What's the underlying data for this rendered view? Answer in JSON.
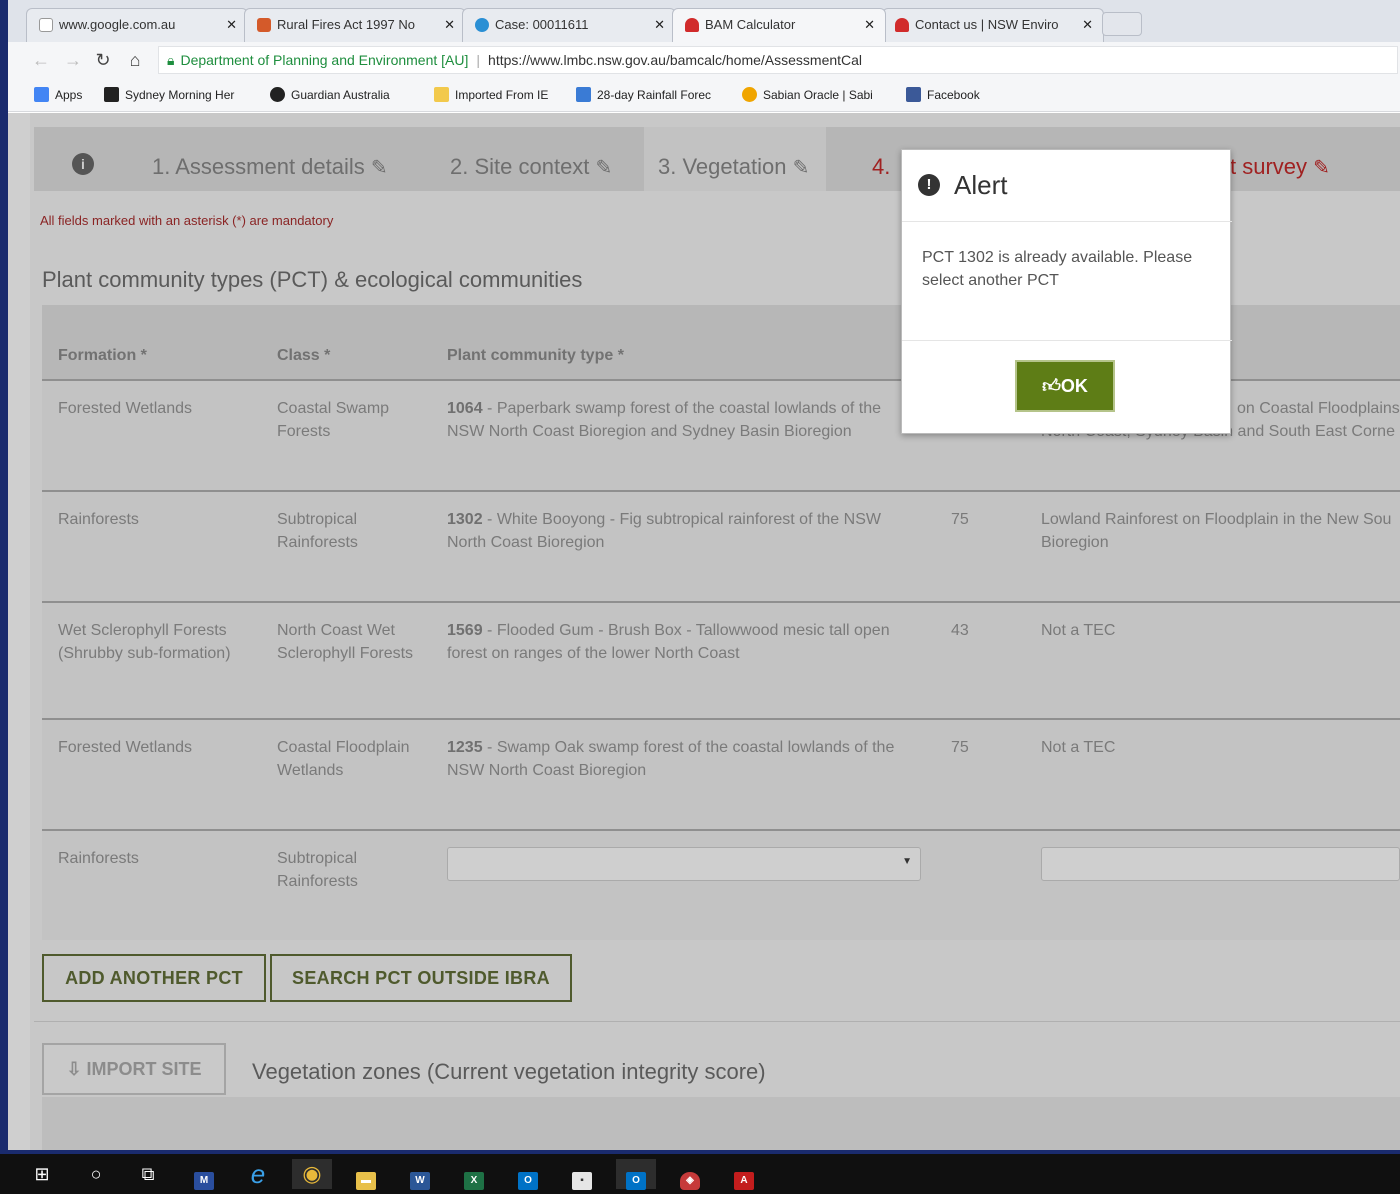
{
  "browser": {
    "tabs": [
      {
        "label": "www.google.com.au",
        "favicon": "page-icon",
        "color": "#ffffff"
      },
      {
        "label": "Rural Fires Act 1997 No",
        "favicon": "crest-icon",
        "color": "#d45a2a"
      },
      {
        "label": "Case: 00011611",
        "favicon": "cloud-icon",
        "color": "#2a8fd4"
      },
      {
        "label": "BAM Calculator",
        "favicon": "nsw-icon",
        "color": "#d12b2b"
      },
      {
        "label": "Contact us | NSW Enviro",
        "favicon": "nsw-icon",
        "color": "#d12b2b"
      }
    ],
    "close_glyph": "✕",
    "address": {
      "org": "Department of Planning and Environment [AU]",
      "separator": "|",
      "url": "https://www.lmbc.nsw.gov.au/bamcalc/home/AssessmentCal"
    },
    "bookmarks": [
      {
        "label": "Apps",
        "icon": "apps-grid-icon",
        "color": "#4285f4"
      },
      {
        "label": "Sydney Morning Her",
        "icon": "smh-icon",
        "color": "#222222"
      },
      {
        "label": "Guardian Australia",
        "icon": "guardian-icon",
        "color": "#222222"
      },
      {
        "label": "Imported From IE",
        "icon": "folder-icon",
        "color": "#f2c94c"
      },
      {
        "label": "28-day Rainfall Forec",
        "icon": "weatherzone-icon",
        "color": "#3a7bd5"
      },
      {
        "label": "Sabian Oracle | Sabi",
        "icon": "sabian-icon",
        "color": "#f0a500"
      },
      {
        "label": "Facebook",
        "icon": "facebook-icon",
        "color": "#3b5998"
      }
    ]
  },
  "wizard": {
    "steps": [
      {
        "label": "1. Assessment details"
      },
      {
        "label": "2. Site context"
      },
      {
        "label": "3. Vegetation"
      },
      {
        "label": "4."
      },
      {
        "label": "t survey"
      }
    ]
  },
  "mandatory_note": "All fields marked with an asterisk (*) are mandatory",
  "section_title": "Plant community types (PCT) & ecological communities",
  "table": {
    "headers": {
      "formation": "Formation *",
      "class": "Class *",
      "pct": "Plant community type *"
    },
    "rows": [
      {
        "formation": "Forested Wetlands",
        "class": "Coastal Swamp Forests",
        "pct_id": "1064",
        "pct_text": " - Paperbark swamp forest of the coastal lowlands of the NSW North Coast Bioregion and Sydney Basin Bioregion",
        "percent": "",
        "tec": "on Coastal Floodplains",
        "tec2": "North Coast, Sydney Basin and South East Corne"
      },
      {
        "formation": "Rainforests",
        "class": "Subtropical Rainforests",
        "pct_id": "1302",
        "pct_text": " - White Booyong - Fig subtropical rainforest of the NSW North Coast Bioregion",
        "percent": "75",
        "tec": "Lowland Rainforest on Floodplain in the New Sou",
        "tec2": "Bioregion"
      },
      {
        "formation": "Wet Sclerophyll Forests (Shrubby sub-formation)",
        "class": "North Coast Wet Sclerophyll Forests",
        "pct_id": "1569",
        "pct_text": " - Flooded Gum - Brush Box - Tallowwood mesic tall open forest on ranges of the lower North Coast",
        "percent": "43",
        "tec": "Not a TEC",
        "tec2": ""
      },
      {
        "formation": "Forested Wetlands",
        "class": "Coastal Floodplain Wetlands",
        "pct_id": "1235",
        "pct_text": " - Swamp Oak swamp forest of the coastal lowlands of the NSW North Coast Bioregion",
        "percent": "75",
        "tec": "Not a TEC",
        "tec2": ""
      },
      {
        "formation": "Rainforests",
        "class": "Subtropical Rainforests",
        "pct_id": "",
        "pct_text": "",
        "percent": "",
        "tec": "",
        "tec2": ""
      }
    ]
  },
  "buttons": {
    "add_pct": "ADD ANOTHER PCT",
    "search_outside": "SEARCH PCT OUTSIDE IBRA",
    "import_site": "IMPORT SITE"
  },
  "zones_title": "Vegetation zones (Current vegetation integrity score)",
  "modal": {
    "title": "Alert",
    "message": "PCT 1302 is already available. Please select another PCT",
    "ok": "OK"
  },
  "taskbar": {
    "items": [
      {
        "name": "windows-start-icon",
        "glyph": "⊞"
      },
      {
        "name": "cortana-search-icon",
        "glyph": "○"
      },
      {
        "name": "task-view-icon",
        "glyph": "⧉"
      },
      {
        "name": "app-icon-1",
        "glyph": "M"
      },
      {
        "name": "internet-explorer-icon",
        "glyph": "e"
      },
      {
        "name": "chrome-icon",
        "glyph": "◉"
      },
      {
        "name": "file-explorer-icon",
        "glyph": "▬"
      },
      {
        "name": "word-icon",
        "glyph": "W"
      },
      {
        "name": "excel-icon",
        "glyph": "X"
      },
      {
        "name": "outlook-icon",
        "glyph": "O"
      },
      {
        "name": "sticky-notes-icon",
        "glyph": "▪"
      },
      {
        "name": "outlook-running-icon",
        "glyph": "O"
      },
      {
        "name": "security-shield-icon",
        "glyph": "◈"
      },
      {
        "name": "acrobat-icon",
        "glyph": "A"
      }
    ]
  }
}
